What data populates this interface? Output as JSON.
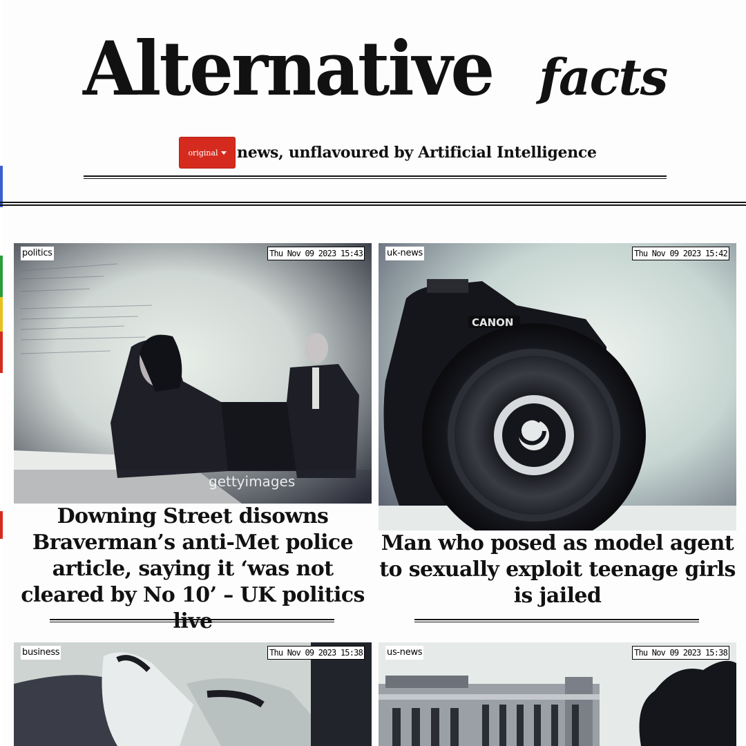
{
  "masthead": {
    "title": "Alternative",
    "title_suffix": "facts",
    "edition_button": "original",
    "tagline": "news, unflavoured by Artificial Intelligence"
  },
  "articles": [
    {
      "category": "politics",
      "timestamp": "Thu Nov 09 2023 15:43",
      "headline": "Downing Street disowns Braverman’s anti-Met police article, saying it ‘was not cleared by No 10’ – UK politics live",
      "image_watermark": "gettyimages"
    },
    {
      "category": "uk-news",
      "timestamp": "Thu Nov 09 2023 15:42",
      "headline": "Man who posed as model agent to sexually exploit teenage girls is jailed",
      "image_label": "CANON"
    },
    {
      "category": "business",
      "timestamp": "Thu Nov 09 2023 15:38",
      "headline": ""
    },
    {
      "category": "us-news",
      "timestamp": "Thu Nov 09 2023 15:38",
      "headline": ""
    }
  ]
}
